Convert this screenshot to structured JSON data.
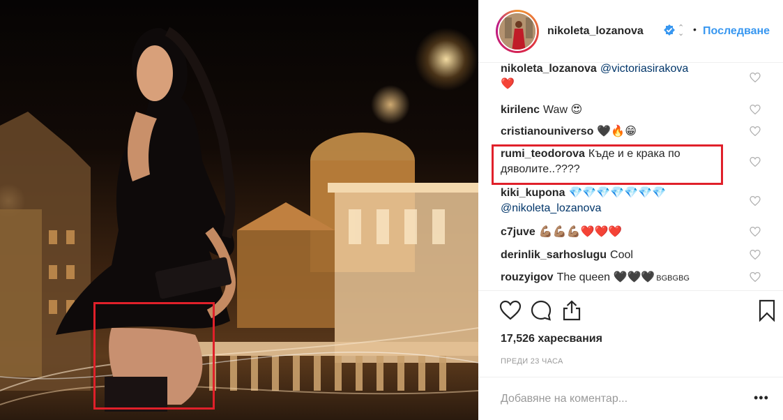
{
  "post": {
    "username": "nikoleta_lozanova",
    "follow_label": "Последване",
    "dot": "•",
    "chevron": "⌃⌄"
  },
  "comments": [
    {
      "user": "nikoleta_lozanova",
      "text": "@victoriasirakova",
      "line2": "❤️"
    },
    {
      "user": "kirilenc",
      "text": "Waw 😍"
    },
    {
      "user": "cristianouniverso",
      "text": "🖤🔥😁"
    },
    {
      "user": "rumi_teodorova",
      "text": "Къде и е крака по",
      "line2": "дяволите..????"
    },
    {
      "user": "kiki_kupona",
      "text": "💎💎💎💎💎💎💎",
      "line2": "@nikoleta_lozanova"
    },
    {
      "user": "c7juve",
      "text": "💪🏽💪🏽💪🏽❤️❤️❤️"
    },
    {
      "user": "derinlik_sarhoslugu",
      "text": "Cool"
    },
    {
      "user": "rouzyigov",
      "text": "The queen 🖤🖤🖤",
      "suffix": "BGBGBG"
    }
  ],
  "likes": "17,526 харесвания",
  "time": "ПРЕДИ 23 ЧАСА",
  "add_comment": {
    "placeholder": "Добавяне на коментар...",
    "more": "•••"
  },
  "colors": {
    "link": "#3897f0",
    "highlight": "#e0202a",
    "verified": "#3897f0"
  },
  "icons": [
    "heart-icon",
    "comment-icon",
    "share-icon",
    "bookmark-icon",
    "verified-badge-icon",
    "more-options-icon"
  ]
}
